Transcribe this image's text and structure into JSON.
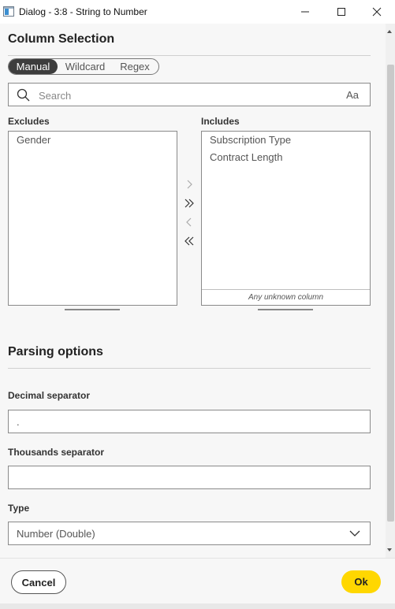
{
  "window": {
    "title": "Dialog - 3:8 - String to Number"
  },
  "column_selection": {
    "title": "Column Selection",
    "modes": [
      {
        "label": "Manual",
        "active": true
      },
      {
        "label": "Wildcard",
        "active": false
      },
      {
        "label": "Regex",
        "active": false
      }
    ],
    "search": {
      "placeholder": "Search",
      "case_toggle": "Aa"
    },
    "excludes": {
      "label": "Excludes",
      "items": [
        "Gender"
      ]
    },
    "includes": {
      "label": "Includes",
      "items": [
        "Subscription Type",
        "Contract Length"
      ],
      "unknown_label": "Any unknown column"
    },
    "move_buttons": [
      "move-right-icon",
      "move-all-right-icon",
      "move-left-icon",
      "move-all-left-icon"
    ]
  },
  "parsing": {
    "title": "Parsing options",
    "decimal": {
      "label": "Decimal separator",
      "value": "."
    },
    "thousands": {
      "label": "Thousands separator",
      "value": ""
    },
    "type": {
      "label": "Type",
      "value": "Number (Double)"
    }
  },
  "footer": {
    "cancel_label": "Cancel",
    "ok_label": "Ok"
  },
  "colors": {
    "accent": "#ffd700",
    "segment_active": "#3d3d3d"
  }
}
